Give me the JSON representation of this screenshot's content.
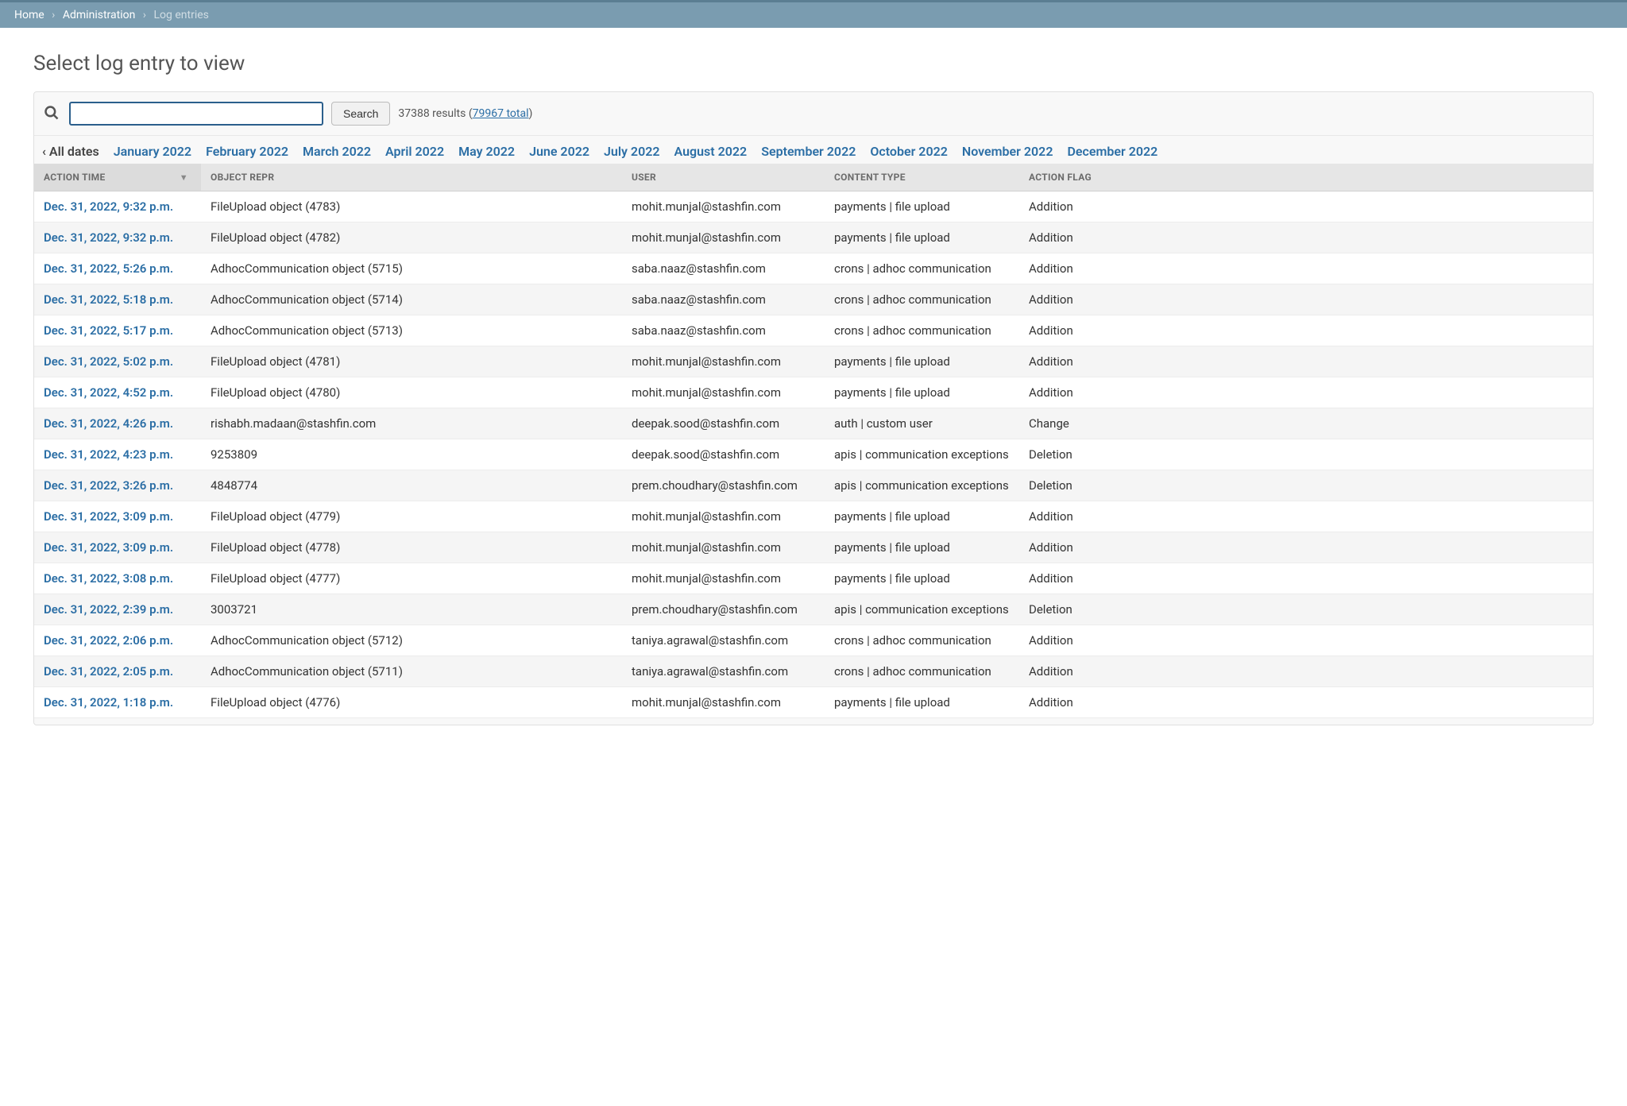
{
  "breadcrumb": {
    "home": "Home",
    "admin": "Administration",
    "current": "Log entries"
  },
  "page_title": "Select log entry to view",
  "search": {
    "button": "Search",
    "results_prefix": "37388 results (",
    "total_link": "79967 total",
    "results_suffix": ")"
  },
  "date_filter": {
    "all": "‹ All dates",
    "months": [
      "January 2022",
      "February 2022",
      "March 2022",
      "April 2022",
      "May 2022",
      "June 2022",
      "July 2022",
      "August 2022",
      "September 2022",
      "October 2022",
      "November 2022",
      "December 2022"
    ]
  },
  "table": {
    "headers": {
      "action_time": "ACTION TIME",
      "object_repr": "OBJECT REPR",
      "user": "USER",
      "content_type": "CONTENT TYPE",
      "action_flag": "ACTION FLAG"
    },
    "rows": [
      {
        "time": "Dec. 31, 2022, 9:32 p.m.",
        "obj": "FileUpload object (4783)",
        "user": "mohit.munjal@stashfin.com",
        "ct": "payments | file upload",
        "flag": "Addition"
      },
      {
        "time": "Dec. 31, 2022, 9:32 p.m.",
        "obj": "FileUpload object (4782)",
        "user": "mohit.munjal@stashfin.com",
        "ct": "payments | file upload",
        "flag": "Addition"
      },
      {
        "time": "Dec. 31, 2022, 5:26 p.m.",
        "obj": "AdhocCommunication object (5715)",
        "user": "saba.naaz@stashfin.com",
        "ct": "crons | adhoc communication",
        "flag": "Addition"
      },
      {
        "time": "Dec. 31, 2022, 5:18 p.m.",
        "obj": "AdhocCommunication object (5714)",
        "user": "saba.naaz@stashfin.com",
        "ct": "crons | adhoc communication",
        "flag": "Addition"
      },
      {
        "time": "Dec. 31, 2022, 5:17 p.m.",
        "obj": "AdhocCommunication object (5713)",
        "user": "saba.naaz@stashfin.com",
        "ct": "crons | adhoc communication",
        "flag": "Addition"
      },
      {
        "time": "Dec. 31, 2022, 5:02 p.m.",
        "obj": "FileUpload object (4781)",
        "user": "mohit.munjal@stashfin.com",
        "ct": "payments | file upload",
        "flag": "Addition"
      },
      {
        "time": "Dec. 31, 2022, 4:52 p.m.",
        "obj": "FileUpload object (4780)",
        "user": "mohit.munjal@stashfin.com",
        "ct": "payments | file upload",
        "flag": "Addition"
      },
      {
        "time": "Dec. 31, 2022, 4:26 p.m.",
        "obj": "rishabh.madaan@stashfin.com",
        "user": "deepak.sood@stashfin.com",
        "ct": "auth | custom user",
        "flag": "Change"
      },
      {
        "time": "Dec. 31, 2022, 4:23 p.m.",
        "obj": "9253809",
        "user": "deepak.sood@stashfin.com",
        "ct": "apis | communication exceptions",
        "flag": "Deletion"
      },
      {
        "time": "Dec. 31, 2022, 3:26 p.m.",
        "obj": "4848774",
        "user": "prem.choudhary@stashfin.com",
        "ct": "apis | communication exceptions",
        "flag": "Deletion"
      },
      {
        "time": "Dec. 31, 2022, 3:09 p.m.",
        "obj": "FileUpload object (4779)",
        "user": "mohit.munjal@stashfin.com",
        "ct": "payments | file upload",
        "flag": "Addition"
      },
      {
        "time": "Dec. 31, 2022, 3:09 p.m.",
        "obj": "FileUpload object (4778)",
        "user": "mohit.munjal@stashfin.com",
        "ct": "payments | file upload",
        "flag": "Addition"
      },
      {
        "time": "Dec. 31, 2022, 3:08 p.m.",
        "obj": "FileUpload object (4777)",
        "user": "mohit.munjal@stashfin.com",
        "ct": "payments | file upload",
        "flag": "Addition"
      },
      {
        "time": "Dec. 31, 2022, 2:39 p.m.",
        "obj": "3003721",
        "user": "prem.choudhary@stashfin.com",
        "ct": "apis | communication exceptions",
        "flag": "Deletion"
      },
      {
        "time": "Dec. 31, 2022, 2:06 p.m.",
        "obj": "AdhocCommunication object (5712)",
        "user": "taniya.agrawal@stashfin.com",
        "ct": "crons | adhoc communication",
        "flag": "Addition"
      },
      {
        "time": "Dec. 31, 2022, 2:05 p.m.",
        "obj": "AdhocCommunication object (5711)",
        "user": "taniya.agrawal@stashfin.com",
        "ct": "crons | adhoc communication",
        "flag": "Addition"
      },
      {
        "time": "Dec. 31, 2022, 1:18 p.m.",
        "obj": "FileUpload object (4776)",
        "user": "mohit.munjal@stashfin.com",
        "ct": "payments | file upload",
        "flag": "Addition"
      }
    ]
  }
}
